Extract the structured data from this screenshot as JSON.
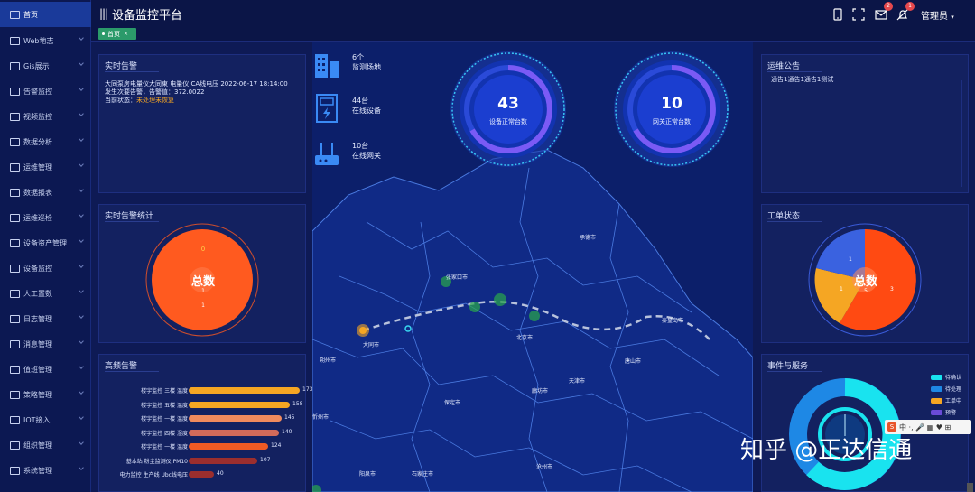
{
  "sidebar": {
    "items": [
      {
        "label": "首页",
        "icon": "chart-icon",
        "active": true
      },
      {
        "label": "Web地志",
        "icon": "document-icon"
      },
      {
        "label": "Gis展示",
        "icon": "map-icon"
      },
      {
        "label": "告警监控",
        "icon": "bell-icon"
      },
      {
        "label": "视频监控",
        "icon": "video-icon"
      },
      {
        "label": "数据分析",
        "icon": "analysis-icon"
      },
      {
        "label": "运维管理",
        "icon": "warning-icon"
      },
      {
        "label": "数据报表",
        "icon": "report-icon"
      },
      {
        "label": "运维巡检",
        "icon": "inspector-icon"
      },
      {
        "label": "设备资产管理",
        "icon": "asset-icon"
      },
      {
        "label": "设备监控",
        "icon": "gear-icon"
      },
      {
        "label": "人工置数",
        "icon": "user-icon"
      },
      {
        "label": "日志管理",
        "icon": "log-icon"
      },
      {
        "label": "消息管理",
        "icon": "message-icon"
      },
      {
        "label": "值班管理",
        "icon": "duty-icon"
      },
      {
        "label": "策略管理",
        "icon": "strategy-icon"
      },
      {
        "label": "IOT接入",
        "icon": "iot-icon"
      },
      {
        "label": "组织管理",
        "icon": "org-icon"
      },
      {
        "label": "系统管理",
        "icon": "settings-icon"
      }
    ]
  },
  "header": {
    "title": "设备监控平台",
    "user": "管理员",
    "mail_badge": "2",
    "bell_badge": "1"
  },
  "tabs": {
    "home": "首页",
    "close": "×"
  },
  "realtime_alarm": {
    "title": "实时告警",
    "lines": [
      "大同泵房电量仪大同東 电量仪 CA线电压 2022-06-17 18:14:00",
      "发生次要告警，告警值：372.0022"
    ],
    "status_label": "当前状态：",
    "status_value": "未处理未恢复"
  },
  "alarm_stats": {
    "title": "实时告警统计",
    "center": "总数",
    "top_value": "0",
    "mid_value": "1",
    "bottom_value": "1",
    "color": "#ff5a1f"
  },
  "frequent_alarms": {
    "title": "高频告警",
    "rows": [
      {
        "name": "楼宇监控 三楼 温度",
        "value": 173,
        "color": "#f5a623"
      },
      {
        "name": "楼宇监控 五楼 温度",
        "value": 158,
        "color": "#f5a623"
      },
      {
        "name": "楼宇监控 一楼 温度",
        "value": 145,
        "color": "#f08a5d"
      },
      {
        "name": "楼宇监控 四楼 湿度",
        "value": 140,
        "color": "#d26a5a"
      },
      {
        "name": "楼宇监控 一楼 温度",
        "value": 124,
        "color": "#ef5a24"
      },
      {
        "name": "基本站 粉尘监测仪 PM10",
        "value": 107,
        "color": "#9b2e2e"
      },
      {
        "name": "电力监控 生产线 Ubc线电压",
        "value": 40,
        "color": "#9b2e2e"
      }
    ],
    "max": 180
  },
  "stats": [
    {
      "count": "6个",
      "label": "监测场地",
      "icon": "building-icon"
    },
    {
      "count": "44台",
      "label": "在线设备",
      "icon": "power-device-icon"
    },
    {
      "count": "10台",
      "label": "在线网关",
      "icon": "router-icon"
    }
  ],
  "gauges": [
    {
      "value": "43",
      "label": "设备正常台数"
    },
    {
      "value": "10",
      "label": "网关正常台数"
    }
  ],
  "map": {
    "cities": [
      {
        "name": "承德市"
      },
      {
        "name": "张家口市"
      },
      {
        "name": "北京市"
      },
      {
        "name": "秦皇岛市"
      },
      {
        "name": "大同市"
      },
      {
        "name": "朔州市"
      },
      {
        "name": "唐山市"
      },
      {
        "name": "廊坊市"
      },
      {
        "name": "天津市"
      },
      {
        "name": "保定市"
      },
      {
        "name": "沧州市"
      },
      {
        "name": "阳泉市"
      },
      {
        "name": "石家庄市"
      },
      {
        "name": "忻州市"
      }
    ]
  },
  "notice": {
    "title": "运维公告",
    "text": "通告1通告1通告1测试"
  },
  "work_order": {
    "title": "工单状态",
    "center": "总数",
    "left_value": "1",
    "top_value": "1",
    "right_value": "3",
    "bottom_value": "5"
  },
  "events": {
    "title": "事件与服务",
    "legend": [
      {
        "label": "待确认",
        "color": "#19e3ef"
      },
      {
        "label": "待处理",
        "color": "#1e88e5"
      },
      {
        "label": "工单中",
        "color": "#f5a623"
      },
      {
        "label": "预警",
        "color": "#6a4bd8"
      }
    ]
  },
  "watermark": "知乎 @正达信通",
  "ime": {
    "badge": "S",
    "text": "中 ·, 🎤 ▦ ♥ ⊞"
  }
}
